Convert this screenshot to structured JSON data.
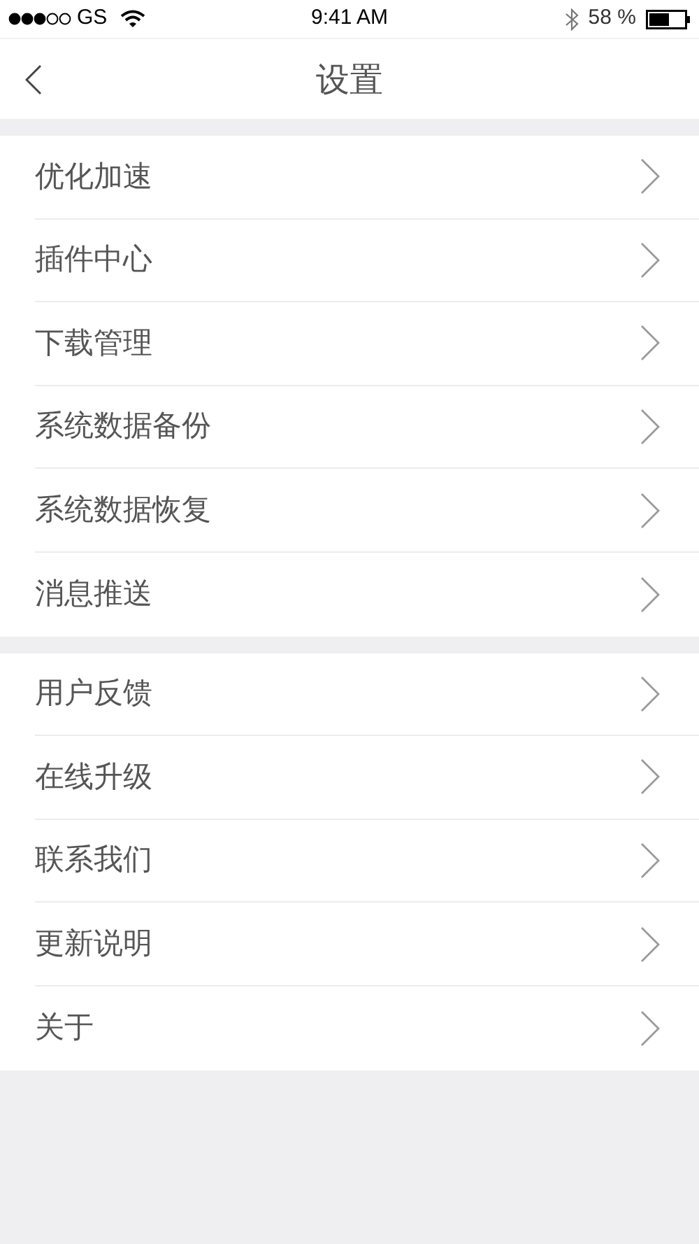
{
  "status_bar": {
    "carrier": "GS",
    "time": "9:41 AM",
    "battery": "58 %"
  },
  "nav": {
    "title": "设置"
  },
  "sections": [
    {
      "items": [
        {
          "label": "优化加速"
        },
        {
          "label": "插件中心"
        },
        {
          "label": "下载管理"
        },
        {
          "label": "系统数据备份"
        },
        {
          "label": "系统数据恢复"
        },
        {
          "label": "消息推送"
        }
      ]
    },
    {
      "items": [
        {
          "label": "用户反馈"
        },
        {
          "label": "在线升级"
        },
        {
          "label": "联系我们"
        },
        {
          "label": "更新说明"
        },
        {
          "label": "关于"
        }
      ]
    }
  ]
}
